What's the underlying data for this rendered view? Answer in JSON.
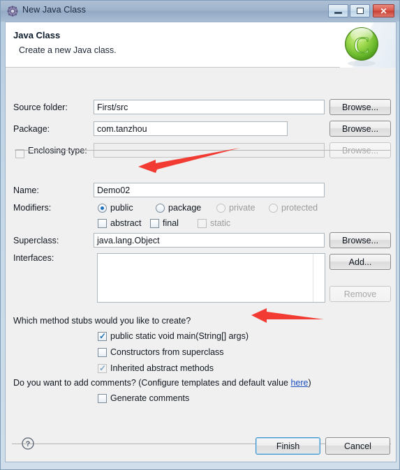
{
  "window": {
    "title": "New Java Class",
    "icon": "gear-icon",
    "minimize_label": "Minimize",
    "maximize_label": "Maximize",
    "close_label": "Close",
    "close_glyph": "✕"
  },
  "header": {
    "title": "Java Class",
    "subtitle": "Create a new Java class.",
    "icon": "java-class-green-c-icon",
    "icon_letter": "C"
  },
  "form": {
    "source_folder": {
      "label": "Source folder:",
      "value": "First/src",
      "browse_label": "Browse...",
      "enabled": true
    },
    "package": {
      "label": "Package:",
      "value": "com.tanzhou",
      "browse_label": "Browse...",
      "enabled": true
    },
    "enclosing_type": {
      "label": "Enclosing type:",
      "value": "",
      "checked": false,
      "browse_label": "Browse...",
      "enabled": false
    },
    "name": {
      "label": "Name:",
      "value": "Demo02"
    },
    "modifiers": {
      "label": "Modifiers:",
      "radios": [
        {
          "label": "public",
          "selected": true,
          "enabled": true
        },
        {
          "label": "package",
          "selected": false,
          "enabled": true
        },
        {
          "label": "private",
          "selected": false,
          "enabled": false
        },
        {
          "label": "protected",
          "selected": false,
          "enabled": false
        }
      ],
      "checkboxes": [
        {
          "label": "abstract",
          "checked": false,
          "enabled": true
        },
        {
          "label": "final",
          "checked": false,
          "enabled": true
        },
        {
          "label": "static",
          "checked": false,
          "enabled": false
        }
      ]
    },
    "superclass": {
      "label": "Superclass:",
      "value": "java.lang.Object",
      "browse_label": "Browse..."
    },
    "interfaces": {
      "label": "Interfaces:",
      "items": [],
      "add_label": "Add...",
      "remove_label": "Remove",
      "remove_enabled": false
    }
  },
  "stubs": {
    "question": "Which method stubs would you like to create?",
    "options": [
      {
        "label": "public static void main(String[] args)",
        "checked": true,
        "enabled": true
      },
      {
        "label": "Constructors from superclass",
        "checked": false,
        "enabled": true
      },
      {
        "label": "Inherited abstract methods",
        "checked": true,
        "enabled": false
      }
    ]
  },
  "comments": {
    "question_prefix": "Do you want to add comments? (Configure templates and default value ",
    "link": "here",
    "question_suffix": ")",
    "option": {
      "label": "Generate comments",
      "checked": false,
      "enabled": true
    }
  },
  "footer": {
    "help_label": "?",
    "finish_label": "Finish",
    "cancel_label": "Cancel"
  },
  "annotations": {
    "arrow_color": "#f23b32",
    "arrows": [
      {
        "name": "arrow-pointing-to-name-field",
        "points_to": "Demo02"
      },
      {
        "name": "arrow-pointing-to-main-stub",
        "points_to": "public static void main(String[] args)"
      }
    ]
  },
  "colors": {
    "accent": "#1d6fb8",
    "title_bar": "#9fb4cc",
    "dialog_bg": "#f0f0f0",
    "header_bg": "#ffffff",
    "link": "#1a4fbf",
    "java_icon_green": "#7ac943"
  }
}
